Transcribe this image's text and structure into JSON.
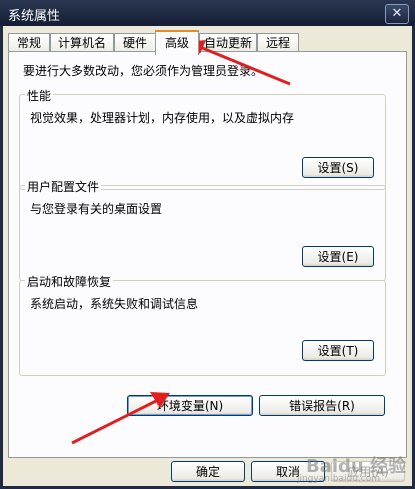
{
  "window": {
    "title": "系统属性",
    "close_icon": "close-icon"
  },
  "tabs": [
    {
      "label": "常规"
    },
    {
      "label": "计算机名"
    },
    {
      "label": "硬件"
    },
    {
      "label": "高级",
      "active": true
    },
    {
      "label": "自动更新"
    },
    {
      "label": "远程"
    }
  ],
  "advanced": {
    "note": "要进行大多数改动，您必须作为管理员登录。",
    "performance": {
      "label": "性能",
      "desc": "视觉效果，处理器计划，内存使用，以及虚拟内存",
      "button": "设置(S)"
    },
    "user_profiles": {
      "label": "用户配置文件",
      "desc": "与您登录有关的桌面设置",
      "button": "设置(E)"
    },
    "startup_recovery": {
      "label": "启动和故障恢复",
      "desc": "系统启动，系统失败和调试信息",
      "button": "设置(T)"
    },
    "env_vars_button": "环境变量(N)",
    "error_report_button": "错误报告(R)"
  },
  "footer": {
    "ok": "确定",
    "cancel": "取消",
    "apply": "应用(A)"
  },
  "watermark": {
    "brand": "Baidu 经验",
    "url": "jingyan.baidu.com"
  },
  "colors": {
    "annotation_arrow": "#e02020",
    "active_tab_accent": "#e68b2c"
  }
}
